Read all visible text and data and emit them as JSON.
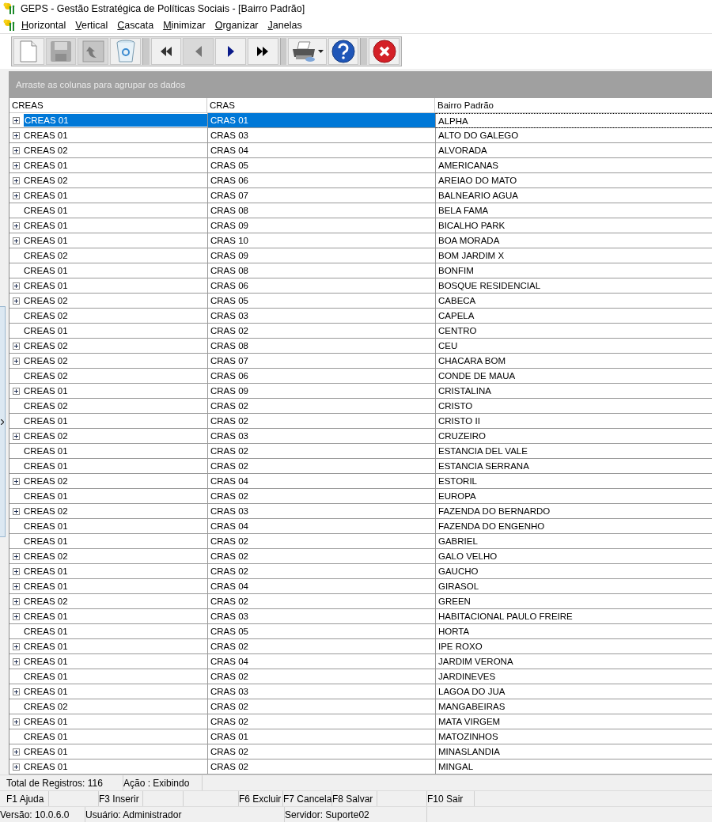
{
  "window": {
    "title": "GEPS - Gestão Estratégica de Políticas Sociais - [Bairro Padrão]"
  },
  "menu": [
    "Horizontal",
    "Vertical",
    "Cascata",
    "Minimizar",
    "Organizar",
    "Janelas"
  ],
  "toolbar": [
    {
      "kind": "new",
      "disabled": false
    },
    {
      "kind": "save",
      "disabled": true
    },
    {
      "kind": "undo",
      "disabled": true
    },
    {
      "kind": "delete",
      "disabled": false
    },
    {
      "kind": "first",
      "disabled": false
    },
    {
      "kind": "prev",
      "disabled": true
    },
    {
      "kind": "next",
      "disabled": false
    },
    {
      "kind": "last",
      "disabled": false
    },
    {
      "kind": "print",
      "disabled": false
    },
    {
      "kind": "help",
      "disabled": false
    },
    {
      "kind": "close",
      "disabled": false
    }
  ],
  "group_panel": {
    "placeholder": "Arraste as colunas para agrupar os dados"
  },
  "table": {
    "columns": [
      "CREAS",
      "CRAS",
      "Bairro Padrão"
    ],
    "rows": [
      {
        "creas": "CREAS 01",
        "cras": "CRAS 01",
        "bairro": "ALPHA",
        "expandable": true,
        "selected": true
      },
      {
        "creas": "CREAS 01",
        "cras": "CRAS 03",
        "bairro": "ALTO DO GALEGO",
        "expandable": true,
        "selected": false
      },
      {
        "creas": "CREAS 02",
        "cras": "CRAS 04",
        "bairro": "ALVORADA",
        "expandable": true,
        "selected": false
      },
      {
        "creas": "CREAS 01",
        "cras": "CRAS 05",
        "bairro": "AMERICANAS",
        "expandable": true,
        "selected": false
      },
      {
        "creas": "CREAS 02",
        "cras": "CRAS 06",
        "bairro": "AREIAO DO MATO",
        "expandable": true,
        "selected": false
      },
      {
        "creas": "CREAS 01",
        "cras": "CRAS 07",
        "bairro": "BALNEARIO AGUA",
        "expandable": true,
        "selected": false
      },
      {
        "creas": "CREAS 01",
        "cras": "CRAS 08",
        "bairro": "BELA FAMA",
        "expandable": false,
        "selected": false
      },
      {
        "creas": "CREAS 01",
        "cras": "CRAS 09",
        "bairro": "BICALHO PARK",
        "expandable": true,
        "selected": false
      },
      {
        "creas": "CREAS 01",
        "cras": "CRAS 10",
        "bairro": "BOA MORADA",
        "expandable": true,
        "selected": false
      },
      {
        "creas": "CREAS 02",
        "cras": "CRAS 09",
        "bairro": "BOM JARDIM X",
        "expandable": false,
        "selected": false
      },
      {
        "creas": "CREAS 01",
        "cras": "CRAS 08",
        "bairro": "BONFIM",
        "expandable": false,
        "selected": false
      },
      {
        "creas": "CREAS 01",
        "cras": "CRAS 06",
        "bairro": "BOSQUE RESIDENCIAL",
        "expandable": true,
        "selected": false
      },
      {
        "creas": "CREAS 02",
        "cras": "CRAS 05",
        "bairro": "CABECA",
        "expandable": true,
        "selected": false
      },
      {
        "creas": "CREAS 02",
        "cras": "CRAS 03",
        "bairro": "CAPELA",
        "expandable": false,
        "selected": false
      },
      {
        "creas": "CREAS 01",
        "cras": "CRAS 02",
        "bairro": "CENTRO",
        "expandable": false,
        "selected": false
      },
      {
        "creas": "CREAS 02",
        "cras": "CRAS 08",
        "bairro": "CEU",
        "expandable": true,
        "selected": false
      },
      {
        "creas": "CREAS 02",
        "cras": "CRAS 07",
        "bairro": "CHACARA BOM",
        "expandable": true,
        "selected": false
      },
      {
        "creas": "CREAS 02",
        "cras": "CRAS 06",
        "bairro": "CONDE DE MAUA",
        "expandable": false,
        "selected": false
      },
      {
        "creas": "CREAS 01",
        "cras": "CRAS 09",
        "bairro": "CRISTALINA",
        "expandable": true,
        "selected": false
      },
      {
        "creas": "CREAS 02",
        "cras": "CRAS 02",
        "bairro": "CRISTO",
        "expandable": false,
        "selected": false
      },
      {
        "creas": "CREAS 01",
        "cras": "CRAS 02",
        "bairro": "CRISTO II",
        "expandable": false,
        "selected": false
      },
      {
        "creas": "CREAS 02",
        "cras": "CRAS 03",
        "bairro": "CRUZEIRO",
        "expandable": true,
        "selected": false
      },
      {
        "creas": "CREAS 01",
        "cras": "CRAS 02",
        "bairro": "ESTANCIA DEL VALE",
        "expandable": false,
        "selected": false
      },
      {
        "creas": "CREAS 01",
        "cras": "CRAS 02",
        "bairro": "ESTANCIA SERRANA",
        "expandable": false,
        "selected": false
      },
      {
        "creas": "CREAS 02",
        "cras": "CRAS 04",
        "bairro": "ESTORIL",
        "expandable": true,
        "selected": false
      },
      {
        "creas": "CREAS 01",
        "cras": "CRAS 02",
        "bairro": "EUROPA",
        "expandable": false,
        "selected": false
      },
      {
        "creas": "CREAS 02",
        "cras": "CRAS 03",
        "bairro": "FAZENDA DO BERNARDO",
        "expandable": true,
        "selected": false
      },
      {
        "creas": "CREAS 01",
        "cras": "CRAS 04",
        "bairro": "FAZENDA DO ENGENHO",
        "expandable": false,
        "selected": false
      },
      {
        "creas": "CREAS 01",
        "cras": "CRAS 02",
        "bairro": "GABRIEL",
        "expandable": false,
        "selected": false
      },
      {
        "creas": "CREAS 02",
        "cras": "CRAS 02",
        "bairro": "GALO VELHO",
        "expandable": true,
        "selected": false
      },
      {
        "creas": "CREAS 01",
        "cras": "CRAS 02",
        "bairro": "GAUCHO",
        "expandable": true,
        "selected": false
      },
      {
        "creas": "CREAS 01",
        "cras": "CRAS 04",
        "bairro": "GIRASOL",
        "expandable": true,
        "selected": false
      },
      {
        "creas": "CREAS 02",
        "cras": "CRAS 02",
        "bairro": "GREEN",
        "expandable": true,
        "selected": false
      },
      {
        "creas": "CREAS 01",
        "cras": "CRAS 03",
        "bairro": "HABITACIONAL PAULO FREIRE",
        "expandable": true,
        "selected": false
      },
      {
        "creas": "CREAS 01",
        "cras": "CRAS 05",
        "bairro": "HORTA",
        "expandable": false,
        "selected": false
      },
      {
        "creas": "CREAS 01",
        "cras": "CRAS 02",
        "bairro": "IPE ROXO",
        "expandable": true,
        "selected": false
      },
      {
        "creas": "CREAS 01",
        "cras": "CRAS 04",
        "bairro": "JARDIM VERONA",
        "expandable": true,
        "selected": false
      },
      {
        "creas": "CREAS 01",
        "cras": "CRAS 02",
        "bairro": "JARDINEVES",
        "expandable": false,
        "selected": false
      },
      {
        "creas": "CREAS 01",
        "cras": "CRAS 03",
        "bairro": "LAGOA DO JUA",
        "expandable": true,
        "selected": false
      },
      {
        "creas": "CREAS 02",
        "cras": "CRAS 02",
        "bairro": "MANGABEIRAS",
        "expandable": false,
        "selected": false
      },
      {
        "creas": "CREAS 01",
        "cras": "CRAS 02",
        "bairro": "MATA VIRGEM",
        "expandable": true,
        "selected": false
      },
      {
        "creas": "CREAS 01",
        "cras": "CRAS 01",
        "bairro": "MATOZINHOS",
        "expandable": false,
        "selected": false
      },
      {
        "creas": "CREAS 01",
        "cras": "CRAS 02",
        "bairro": "MINASLANDIA",
        "expandable": true,
        "selected": false
      },
      {
        "creas": "CREAS 01",
        "cras": "CRAS 02",
        "bairro": "MINGAL",
        "expandable": true,
        "selected": false
      }
    ]
  },
  "status_bar": {
    "info": [
      "Total de Registros: 116",
      "Ação : Exibindo"
    ],
    "function_keys": [
      "F1 Ajuda",
      "F3 Inserir",
      "F6 Excluir",
      "F7 Cancela",
      "F8 Salvar",
      "F10 Sair"
    ],
    "session": [
      "Versão: 10.0.6.0",
      "Usuário: Administrador",
      "Servidor: Suporte02"
    ]
  }
}
